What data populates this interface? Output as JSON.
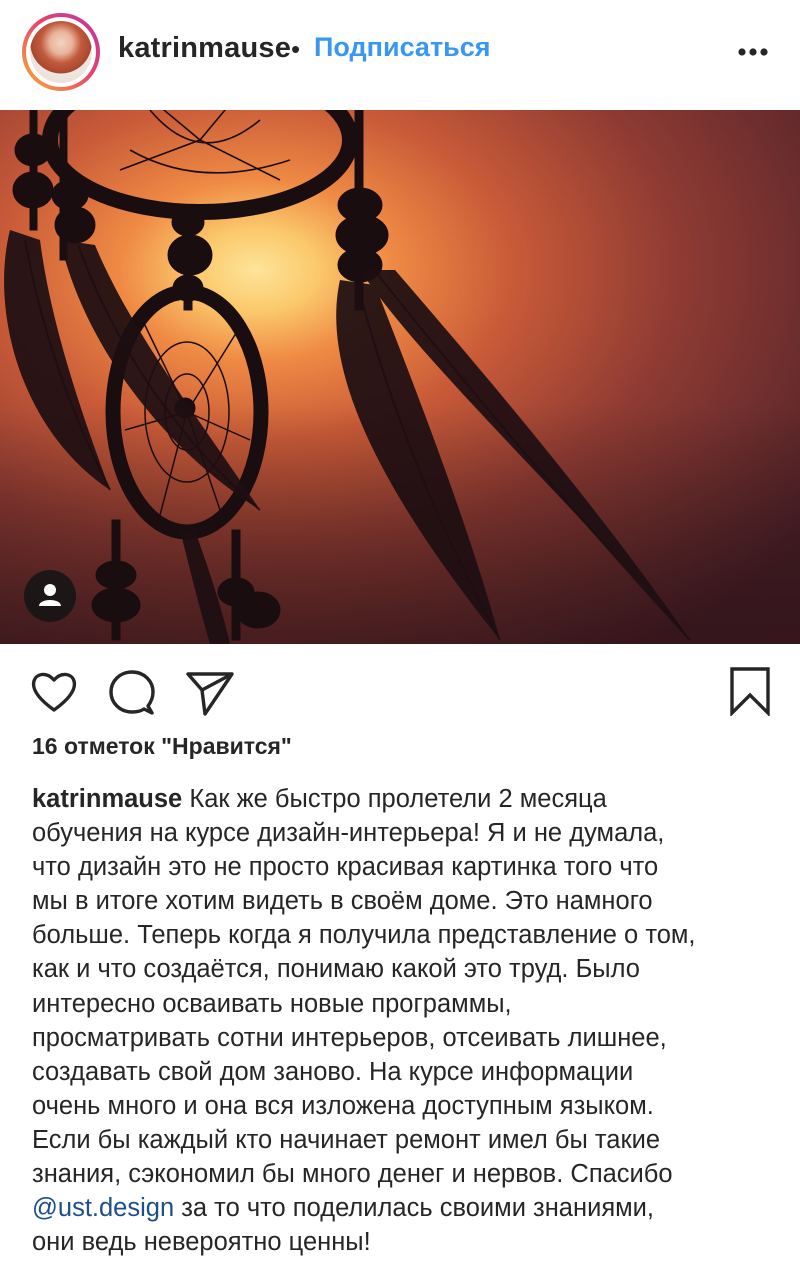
{
  "header": {
    "username": "katrinmause",
    "separator": "•",
    "follow_label": "Подписаться",
    "more_icon": "more-horizontal-icon"
  },
  "photo": {
    "subject": "dreamcatcher-silhouette-sunset",
    "tag_icon": "user-tag-icon"
  },
  "actions": {
    "like_icon": "heart-icon",
    "comment_icon": "comment-icon",
    "share_icon": "paper-plane-icon",
    "save_icon": "bookmark-icon"
  },
  "likes": {
    "text": "16 отметок \"Нравится\""
  },
  "caption": {
    "author": "katrinmause",
    "lines": [
      " Как же быстро пролетели 2 месяца",
      "обучения на курсе дизайн-интерьера! Я и не думала,",
      "что дизайн это не просто красивая картинка того что",
      "мы в итоге хотим видеть в своём доме. Это намного",
      "больше. Теперь когда я получила представление о том,",
      "как и что создаётся, понимаю какой это труд. Было",
      "интересно осваивать новые программы,",
      "просматривать сотни интерьеров, отсеивать лишнее,",
      "создавать свой дом заново. На курсе информации",
      "очень много и она вся изложена доступным языком.",
      "Если бы каждый кто начинает ремонт имел бы такие",
      "знания, сэкономил бы много денег и нервов. Спасибо"
    ],
    "mention": "@ust.design",
    "mention_tail": " за то что поделилась своими знаниями,",
    "last_line": "они ведь невероятно ценны!"
  },
  "colors": {
    "link_blue": "#3897f0",
    "mention_blue": "#1d4f8c",
    "text": "#262626"
  }
}
